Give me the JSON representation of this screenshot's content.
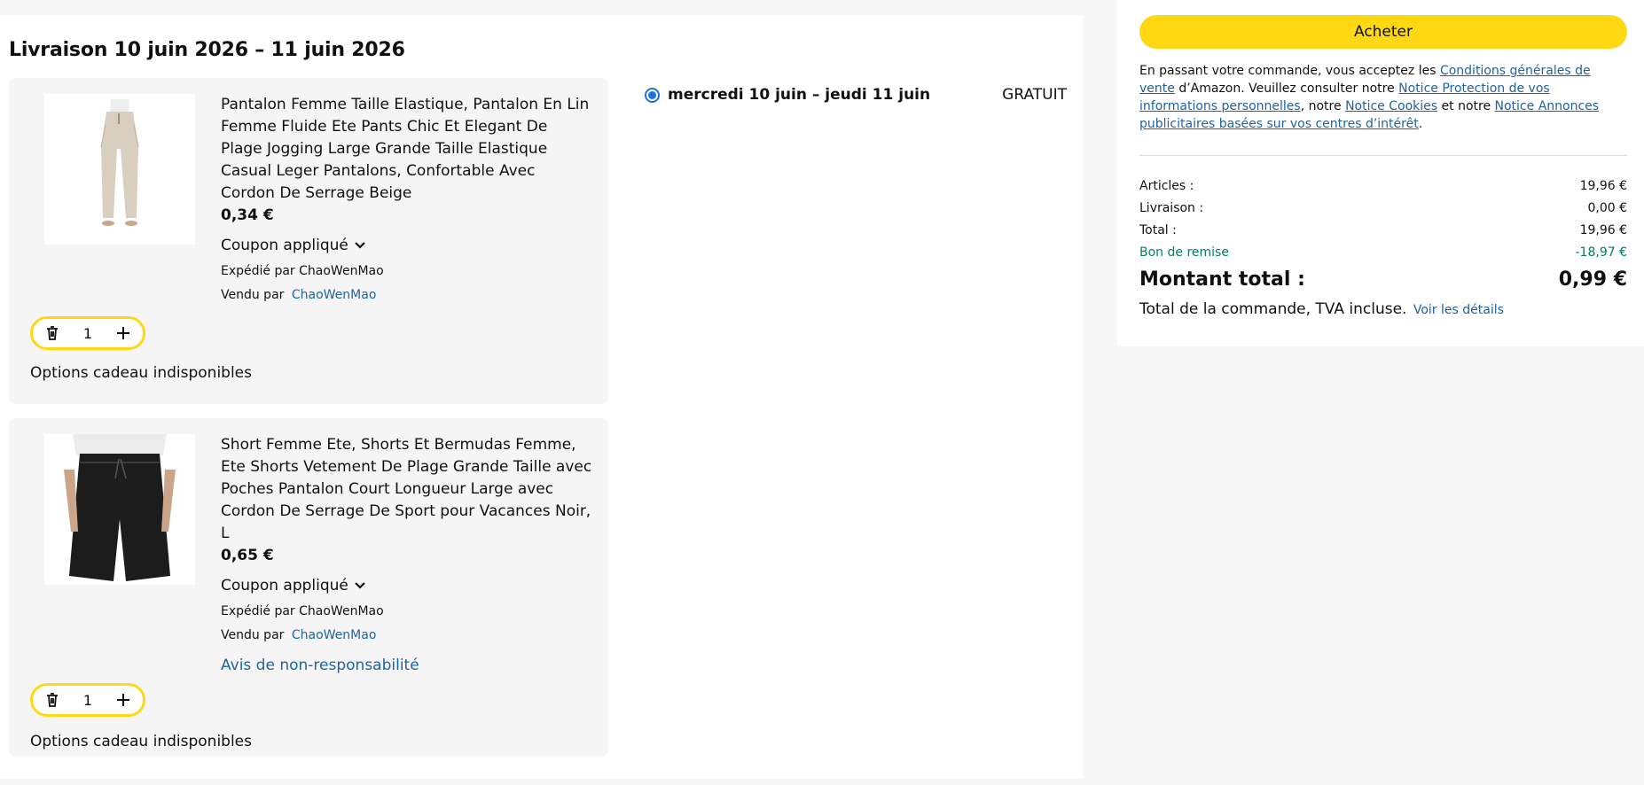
{
  "delivery_section": {
    "title": "Livraison 10 juin 2026 – 11 juin 2026",
    "option_label": "mercredi 10 juin – jeudi 11 juin",
    "option_price": "GRATUIT"
  },
  "items": [
    {
      "title": "Pantalon Femme Taille Elastique, Pantalon En Lin Femme Fluide Ete Pants Chic Et Elegant De Plage Jogging Large Grande Taille Elastique Casual Leger Pantalons, Confortable Avec Cordon De Serrage Beige",
      "price": "0,34 €",
      "coupon": "Coupon appliqué",
      "shipped_by": "Expédié par ChaoWenMao",
      "sold_by_label": "Vendu par",
      "seller": "ChaoWenMao",
      "quantity": "1",
      "gift": "Options cadeau indisponibles",
      "image_icon": "beige-linen-pants-image",
      "color": "#d9cfc1"
    },
    {
      "title": "Short Femme Ete, Shorts Et Bermudas Femme, Ete Shorts Vetement De Plage Grande Taille avec Poches Pantalon Court Longueur Large avec Cordon De Serrage De Sport pour Vacances Noir, L",
      "price": "0,65 €",
      "coupon": "Coupon appliqué",
      "shipped_by": "Expédié par ChaoWenMao",
      "sold_by_label": "Vendu par",
      "seller": "ChaoWenMao",
      "disclaimer": "Avis de non-responsabilité",
      "quantity": "1",
      "gift": "Options cadeau indisponibles",
      "image_icon": "black-shorts-image",
      "color": "#1c1c1c"
    }
  ],
  "summary": {
    "buy_button": "Acheter",
    "legal_prefix": "En passant votre commande, vous acceptez les ",
    "legal_link1": "Conditions générales de vente",
    "legal_mid1": " d’Amazon. Veuillez consulter notre ",
    "legal_link2": "Notice Protection de vos informations personnelles",
    "legal_mid2": ", notre ",
    "legal_link3": "Notice Cookies",
    "legal_mid3": " et notre ",
    "legal_link4": "Notice Annonces publicitaires basées sur vos centres d’intérêt",
    "legal_suffix": ".",
    "rows": [
      {
        "label": "Articles :",
        "value": "19,96 €"
      },
      {
        "label": "Livraison :",
        "value": "0,00 €"
      },
      {
        "label": "Total :",
        "value": "19,96 €"
      },
      {
        "label": "Bon de remise",
        "value": "-18,97 €"
      }
    ],
    "discount_color": "#067d62",
    "grand_total_label": "Montant total :",
    "grand_total_value": "0,99 €",
    "tax_note": "Total de la commande, TVA incluse.",
    "details_link": "Voir les détails"
  },
  "colors": {
    "accent_yellow": "#ffd814",
    "link_blue": "#2162a1",
    "radio_blue": "#1a73e8"
  }
}
